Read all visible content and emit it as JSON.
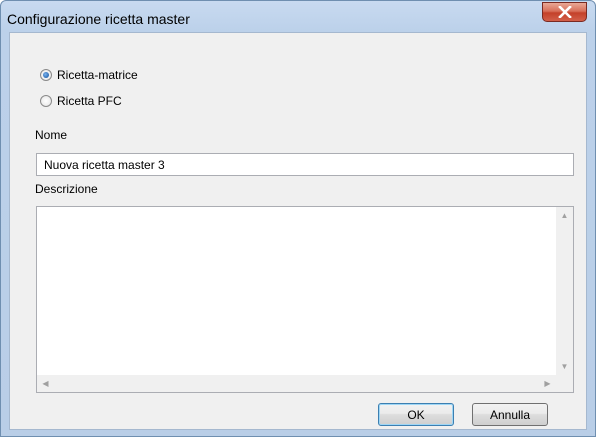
{
  "window": {
    "title": "Configurazione ricetta master"
  },
  "options": [
    {
      "label": "Ricetta-matrice",
      "selected": true
    },
    {
      "label": "Ricetta PFC",
      "selected": false
    }
  ],
  "name_field": {
    "label": "Nome",
    "value": "Nuova ricetta master 3"
  },
  "description_field": {
    "label": "Descrizione",
    "value": ""
  },
  "buttons": {
    "ok": "OK",
    "cancel": "Annulla"
  },
  "colors": {
    "close_button": "#c4412a",
    "default_button_border": "#3c7fb1"
  }
}
